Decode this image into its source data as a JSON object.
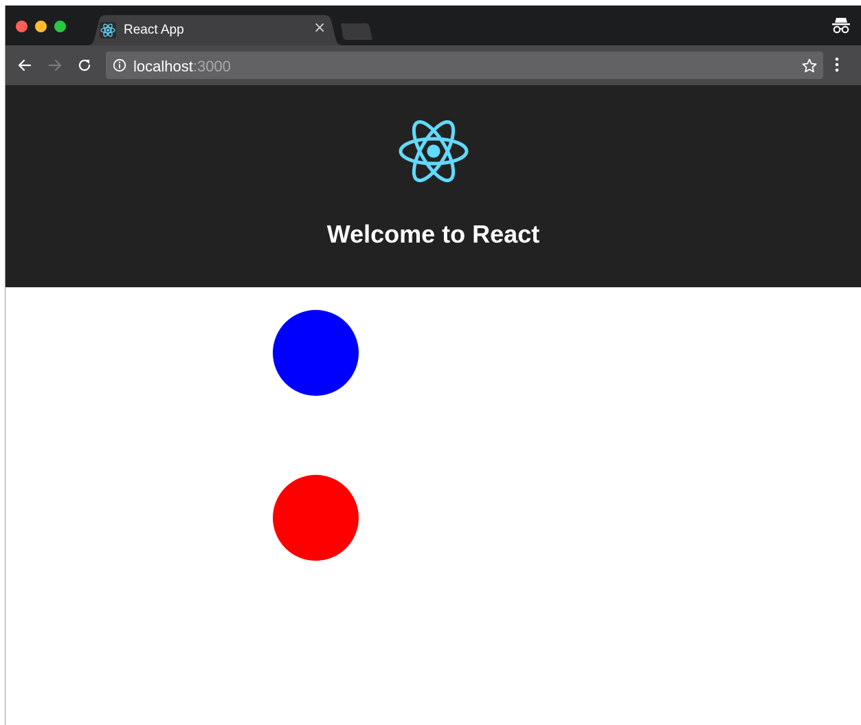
{
  "browser": {
    "tab": {
      "title": "React App",
      "close_glyph": "×",
      "favicon_icon": "react-logo-icon"
    },
    "toolbar": {
      "back_icon": "arrow-left-icon",
      "forward_icon": "arrow-right-icon",
      "reload_icon": "reload-icon",
      "url_host": "localhost",
      "url_port": ":3000",
      "bookmark_icon": "star-icon",
      "menu_icon": "kebab-menu-icon"
    },
    "incognito_icon": "incognito-icon",
    "colors": {
      "close": "#ff5f57",
      "minimize": "#febc2e",
      "maximize": "#28c840"
    }
  },
  "app": {
    "header_title": "Welcome to React",
    "logo_icon": "react-logo-icon",
    "logo_color": "#61dafb",
    "header_background": "#222222",
    "circles": [
      {
        "name": "blue-circle",
        "color": "#0000ff"
      },
      {
        "name": "red-circle",
        "color": "#ff0000"
      }
    ]
  }
}
